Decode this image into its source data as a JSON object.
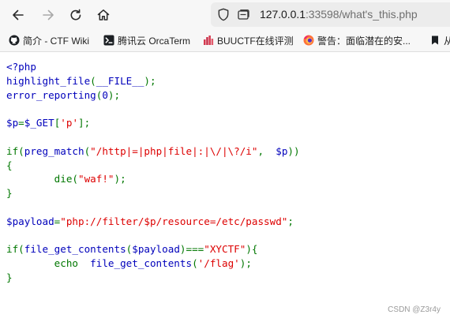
{
  "browser": {
    "url_host": "127.0.0.1",
    "url_rest": ":33598/what's_this.php"
  },
  "bookmarks": [
    {
      "label": "简介 - CTF Wiki",
      "icon": "github-icon"
    },
    {
      "label": "腾讯云 OrcaTerm",
      "icon": "orcaterm-icon"
    },
    {
      "label": "BUUCTF在线评测",
      "icon": "buuctf-icon"
    },
    {
      "label": "警告：面临潜在的安...",
      "icon": "firefox-icon"
    },
    {
      "label": "从",
      "icon": "bookmark-icon"
    }
  ],
  "code": {
    "l1": "<?php",
    "l2a": "highlight_file",
    "l2b": "(",
    "l2c": "__FILE__",
    "l2d": ");",
    "l3a": "error_reporting",
    "l3b": "(",
    "l3c": "0",
    "l3d": ");",
    "l5a": "$p",
    "l5b": "=",
    "l5c": "$_GET",
    "l5d": "[",
    "l5e": "'p'",
    "l5f": "];",
    "l7a": "if(",
    "l7b": "preg_match",
    "l7c": "(",
    "l7d": "\"/http|=|php|file|:|\\/|\\?/i\"",
    "l7e": ",  ",
    "l7f": "$p",
    "l7g": "))",
    "l8": "{",
    "l9a": "        die(",
    "l9b": "\"waf!\"",
    "l9c": ");",
    "l10": "}",
    "l12a": "$payload",
    "l12b": "=",
    "l12c": "\"php://filter/$p/resource=/etc/passwd\"",
    "l12d": ";",
    "l14a": "if(",
    "l14b": "file_get_contents",
    "l14c": "(",
    "l14d": "$payload",
    "l14e": ")===",
    "l14f": "\"XYCTF\"",
    "l14g": "){",
    "l15a": "        echo  ",
    "l15b": "file_get_contents",
    "l15c": "(",
    "l15d": "'/flag'",
    "l15e": ");",
    "l16": "}"
  },
  "watermark": "CSDN @Z3r4y",
  "colors": {
    "php_default": "#0000bb",
    "php_keyword": "#007700",
    "php_string": "#dd0000"
  }
}
